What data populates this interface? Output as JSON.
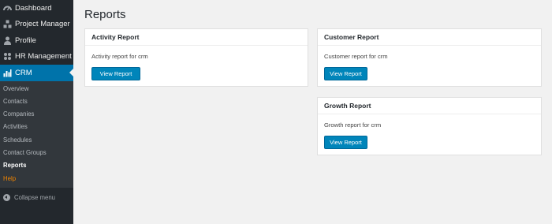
{
  "sidebar": {
    "top_items": [
      {
        "label": "Dashboard",
        "icon": "dashboard-icon"
      },
      {
        "label": "Project Manager",
        "icon": "project-manager-icon"
      },
      {
        "label": "Profile",
        "icon": "user-icon"
      },
      {
        "label": "HR Management",
        "icon": "hr-management-icon"
      },
      {
        "label": "CRM",
        "icon": "crm-chart-icon",
        "active": true
      }
    ],
    "submenu": [
      "Overview",
      "Contacts",
      "Companies",
      "Activities",
      "Schedules",
      "Contact Groups",
      "Reports",
      "Help"
    ],
    "collapse_label": "Collapse menu"
  },
  "page": {
    "title": "Reports",
    "cards": [
      {
        "title": "Activity Report",
        "desc": "Activity report for crm",
        "button": "View Report"
      },
      {
        "title": "Customer Report",
        "desc": "Customer report for crm",
        "button": "View Report"
      },
      {
        "title": "Growth Report",
        "desc": "Growth report for crm",
        "button": "View Report"
      }
    ]
  },
  "colors": {
    "sidebar_bg": "#23282d",
    "submenu_bg": "#32373c",
    "accent": "#0073aa",
    "button": "#0085ba",
    "help": "#f18500"
  }
}
